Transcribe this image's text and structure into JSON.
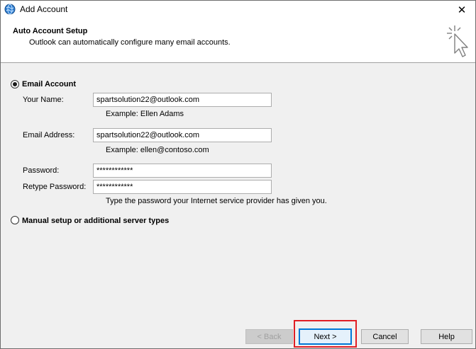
{
  "window": {
    "title": "Add Account",
    "close_glyph": "✕"
  },
  "header": {
    "title": "Auto Account Setup",
    "subtitle": "Outlook can automatically configure many email accounts.",
    "icon": "cursor-click-icon"
  },
  "email_account": {
    "label": "Email Account",
    "selected": true,
    "fields": {
      "your_name": {
        "label": "Your Name:",
        "value": "spartsolution22@outlook.com",
        "hint": "Example: Ellen Adams"
      },
      "email_address": {
        "label": "Email Address:",
        "value": "spartsolution22@outlook.com",
        "hint": "Example: ellen@contoso.com"
      },
      "password": {
        "label": "Password:",
        "value": "************"
      },
      "retype_password": {
        "label": "Retype Password:",
        "value": "************",
        "hint": "Type the password your Internet service provider has given you."
      }
    }
  },
  "manual_setup": {
    "label": "Manual setup or additional server types",
    "selected": false
  },
  "buttons": {
    "back": "< Back",
    "next": "Next >",
    "cancel": "Cancel",
    "help": "Help"
  },
  "colors": {
    "highlight": "#e01e24",
    "primary_border": "#0078d7"
  }
}
